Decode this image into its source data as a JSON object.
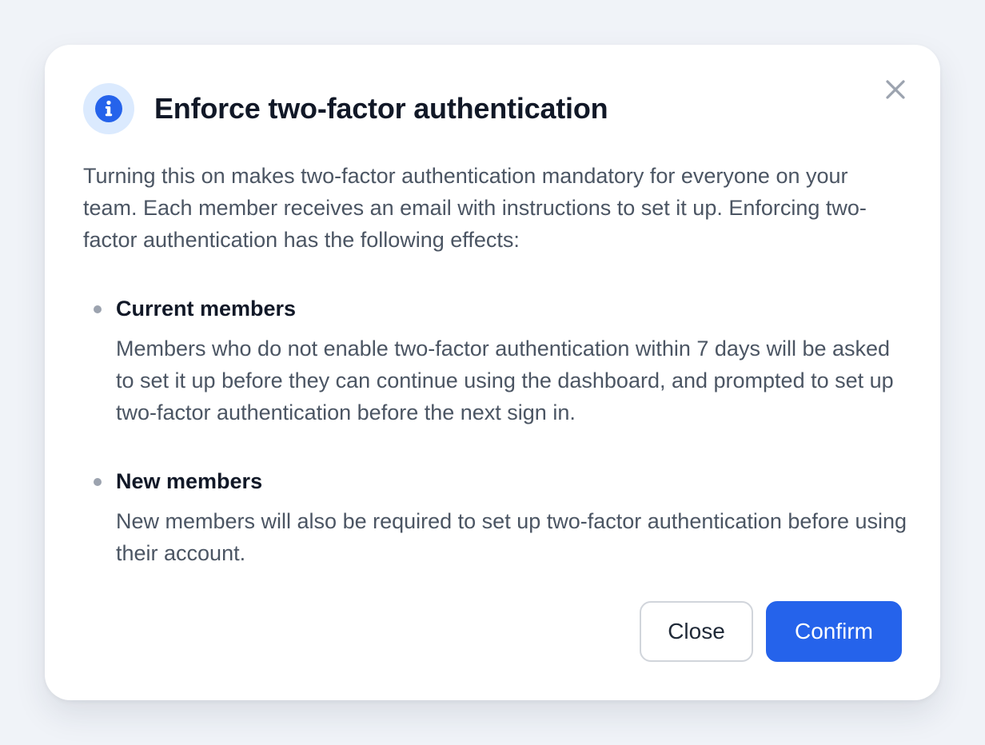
{
  "dialog": {
    "icon": "info-icon",
    "title": "Enforce two-factor authentication",
    "intro": "Turning this on makes two-factor authentication mandatory for everyone on your team. Each member receives an email with instructions to set it up. Enforcing two-factor authentication has the following effects:",
    "effects": [
      {
        "title": "Current members",
        "text": "Members who do not enable two-factor authentication within 7 days will be asked to set it up before they can continue using the dashboard, and prompted to set up two-factor authentication before the next sign in."
      },
      {
        "title": "New members",
        "text": "New members will also be required to set up two-factor authentication before using their account."
      }
    ],
    "close_icon": "close-icon",
    "buttons": {
      "close_label": "Close",
      "confirm_label": "Confirm"
    }
  },
  "colors": {
    "background": "#f0f3f8",
    "accent": "#2563eb",
    "icon_badge": "#dbeafe"
  }
}
